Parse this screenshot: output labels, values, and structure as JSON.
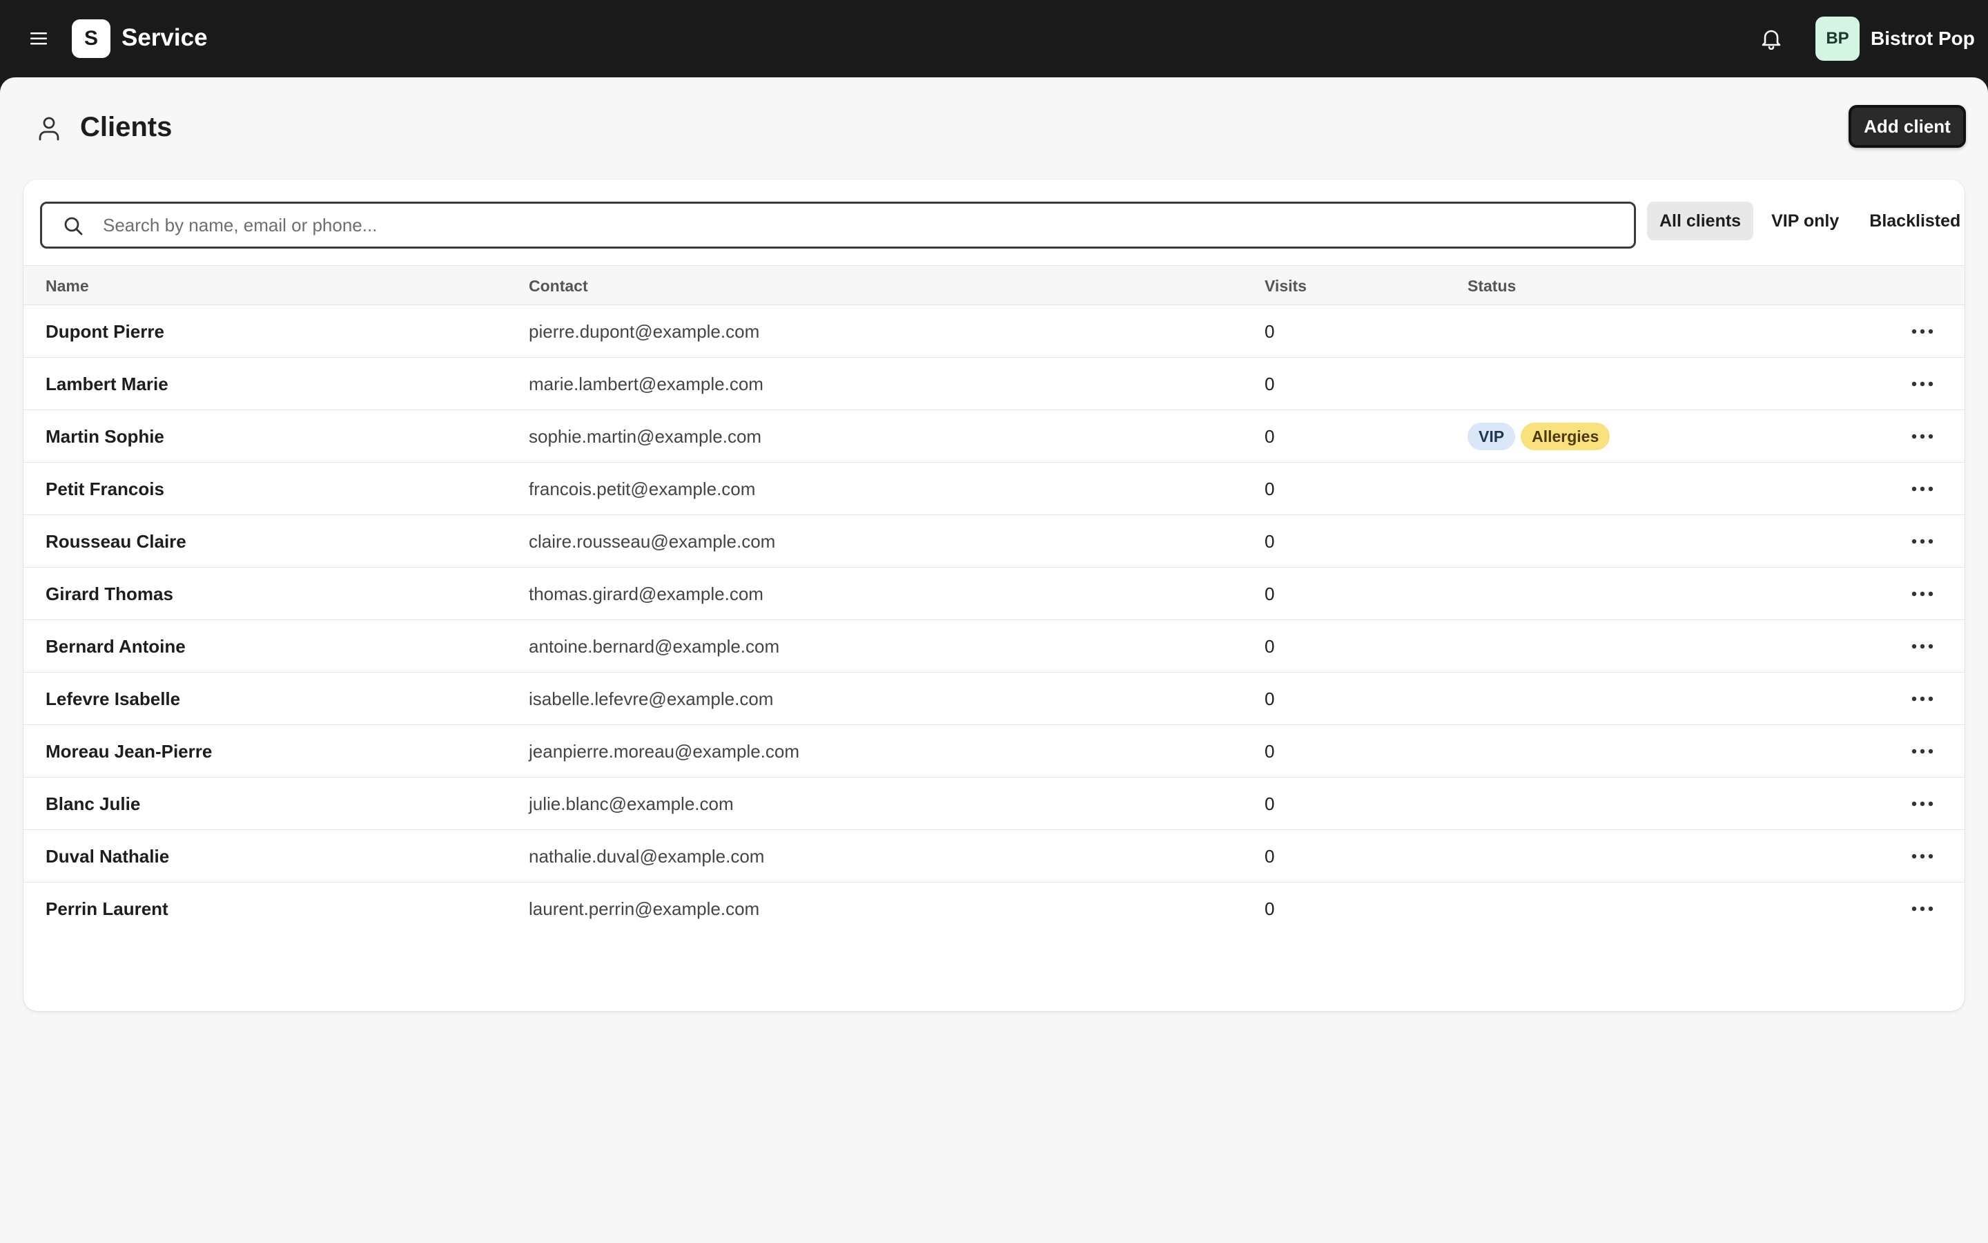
{
  "app": {
    "logo_letter": "S",
    "title": "Service"
  },
  "account": {
    "initials": "BP",
    "name": "Bistrot Pop",
    "avatar_color": "#d4f5e4"
  },
  "page": {
    "title": "Clients",
    "add_button": "Add client"
  },
  "search": {
    "placeholder": "Search by name, email or phone...",
    "value": ""
  },
  "filters": [
    {
      "label": "All clients",
      "active": true
    },
    {
      "label": "VIP only",
      "active": false
    },
    {
      "label": "Blacklisted",
      "active": false
    }
  ],
  "table": {
    "columns": [
      "Name",
      "Contact",
      "Visits",
      "Status"
    ],
    "rows": [
      {
        "name": "Dupont Pierre",
        "contact": "pierre.dupont@example.com",
        "visits": "0",
        "badges": []
      },
      {
        "name": "Lambert Marie",
        "contact": "marie.lambert@example.com",
        "visits": "0",
        "badges": []
      },
      {
        "name": "Martin Sophie",
        "contact": "sophie.martin@example.com",
        "visits": "0",
        "badges": [
          "VIP",
          "Allergies"
        ]
      },
      {
        "name": "Petit Francois",
        "contact": "francois.petit@example.com",
        "visits": "0",
        "badges": []
      },
      {
        "name": "Rousseau Claire",
        "contact": "claire.rousseau@example.com",
        "visits": "0",
        "badges": []
      },
      {
        "name": "Girard Thomas",
        "contact": "thomas.girard@example.com",
        "visits": "0",
        "badges": []
      },
      {
        "name": "Bernard Antoine",
        "contact": "antoine.bernard@example.com",
        "visits": "0",
        "badges": []
      },
      {
        "name": "Lefevre Isabelle",
        "contact": "isabelle.lefevre@example.com",
        "visits": "0",
        "badges": []
      },
      {
        "name": "Moreau Jean-Pierre",
        "contact": "jeanpierre.moreau@example.com",
        "visits": "0",
        "badges": []
      },
      {
        "name": "Blanc Julie",
        "contact": "julie.blanc@example.com",
        "visits": "0",
        "badges": []
      },
      {
        "name": "Duval Nathalie",
        "contact": "nathalie.duval@example.com",
        "visits": "0",
        "badges": []
      },
      {
        "name": "Perrin Laurent",
        "contact": "laurent.perrin@example.com",
        "visits": "0",
        "badges": []
      }
    ]
  },
  "badge_colors": {
    "VIP": {
      "bg": "#dbe6f7",
      "fg": "#1f3550"
    },
    "Allergies": {
      "bg": "#f9e27d",
      "fg": "#4a3a06"
    }
  },
  "icons": {
    "menu": "menu-icon",
    "bell": "bell-icon",
    "user": "user-icon",
    "search": "search-icon",
    "more": "more-horizontal-icon"
  }
}
